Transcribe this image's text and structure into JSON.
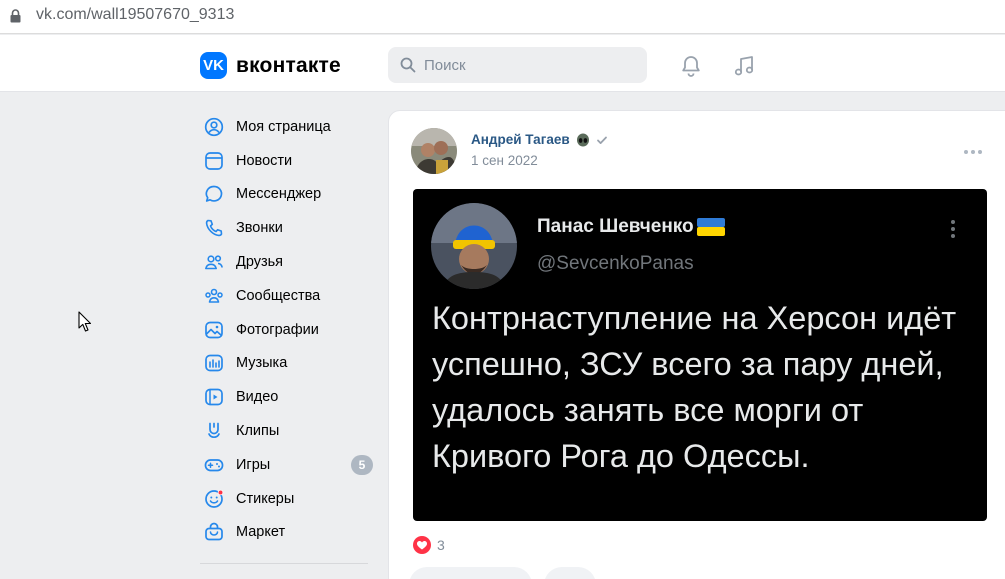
{
  "browser": {
    "url": "vk.com/wall19507670_9313"
  },
  "header": {
    "logo_mark": "VK",
    "logo_text": "вконтакте",
    "search_placeholder": "Поиск"
  },
  "sidebar": {
    "items": [
      {
        "label": "Моя страница",
        "icon": "user-circle-icon"
      },
      {
        "label": "Новости",
        "icon": "newsfeed-icon"
      },
      {
        "label": "Мессенджер",
        "icon": "message-icon"
      },
      {
        "label": "Звонки",
        "icon": "phone-icon"
      },
      {
        "label": "Друзья",
        "icon": "friends-icon"
      },
      {
        "label": "Сообщества",
        "icon": "communities-icon"
      },
      {
        "label": "Фотографии",
        "icon": "photo-icon"
      },
      {
        "label": "Музыка",
        "icon": "music-icon"
      },
      {
        "label": "Видео",
        "icon": "video-icon"
      },
      {
        "label": "Клипы",
        "icon": "clips-icon"
      },
      {
        "label": "Игры",
        "icon": "gamepad-icon",
        "badge": "5"
      },
      {
        "label": "Стикеры",
        "icon": "sticker-icon"
      },
      {
        "label": "Маркет",
        "icon": "market-icon"
      }
    ]
  },
  "post": {
    "author": "Андрей Тагаев",
    "date": "1 сен 2022",
    "likes_count": "3",
    "image": {
      "name": "Панас Шевченко",
      "handle": "@SevcenkoPanas",
      "text": "Контрнаступление на Херсон идёт успешно, ЗСУ всего за пару дней, удалось занять все морги от Кривого Рога до Одессы."
    }
  },
  "colors": {
    "vk_blue": "#0077ff",
    "link": "#2a5885",
    "secondary_text": "#818c99",
    "sidebar_icon": "#2688eb",
    "like_red": "#ff3347"
  }
}
